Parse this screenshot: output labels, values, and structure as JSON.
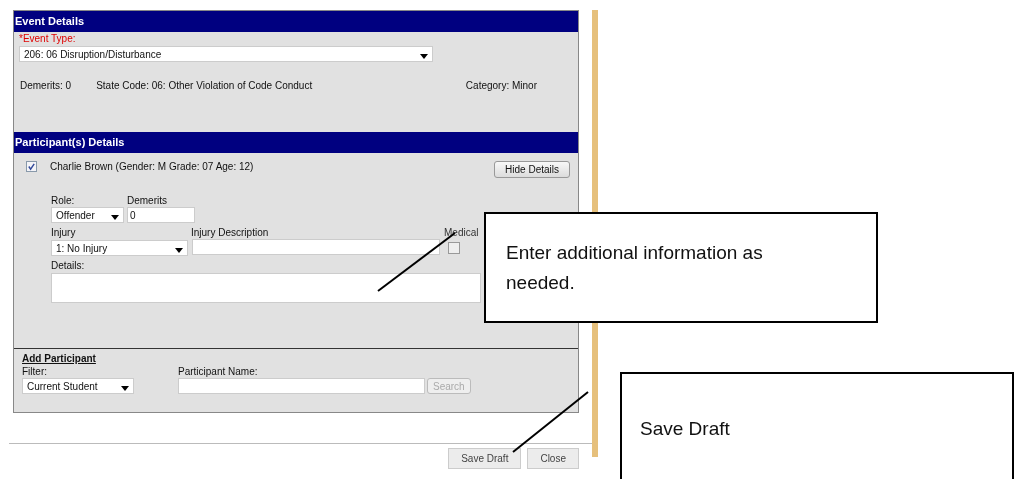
{
  "event_details": {
    "title": "Event Details",
    "event_type_label": "*Event Type:",
    "event_type": "206: 06 Disruption/Disturbance",
    "demerits": "Demerits: 0",
    "state_code": "State Code: 06: Other Violation of Code Conduct",
    "category": "Category: Minor"
  },
  "participants": {
    "title": "Participant(s) Details",
    "items": [
      {
        "name": "Charlie Brown (Gender: M Grade: 07 Age: 12)",
        "checked": true,
        "hide_button": "Hide Details",
        "role_label": "Role:",
        "role": "Offender",
        "demerits_label": "Demerits",
        "demerits": "0",
        "injury_label": "Injury",
        "injury": "1: No Injury",
        "injury_desc_label": "Injury Description",
        "medical_label": "Medical",
        "medical_checked": false,
        "details_label": "Details:"
      }
    ]
  },
  "add_participant": {
    "title": "Add Participant",
    "filter_label": "Filter:",
    "filter": "Current Student",
    "name_label": "Participant Name:",
    "search_button": "Search",
    "search_disabled": true
  },
  "buttons": [
    {
      "label": "Save Draft"
    },
    {
      "label": "Close"
    }
  ],
  "callouts": [
    {
      "text": "Enter additional information as needed."
    },
    {
      "text": "Save Draft"
    }
  ]
}
